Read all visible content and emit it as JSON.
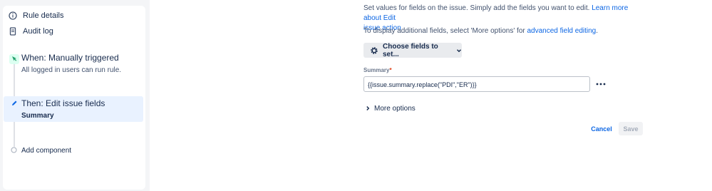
{
  "sidebar": {
    "rule_details": "Rule details",
    "audit_log": "Audit log",
    "trigger": {
      "title": "When: Manually triggered",
      "subtitle": "All logged in users can run rule."
    },
    "action": {
      "title": "Then: Edit issue fields",
      "subtitle": "Summary"
    },
    "add_component": "Add component"
  },
  "main": {
    "intro_text": "Set values for fields on the issue. Simply add the fields you want to edit. ",
    "intro_link_1": "Learn more about Edit",
    "intro_link_2": "issue action",
    "additional_text": "To display additional fields, select 'More options' for ",
    "additional_link": "advanced field editing",
    "additional_end": ".",
    "choose_fields_label": "Choose fields to set...",
    "field_label": "Summary",
    "required_mark": "*",
    "field_value": "{{issue.summary.replace(\"PDI\",\"ER\")}}",
    "more_options": "More options",
    "cancel": "Cancel",
    "save": "Save"
  },
  "colors": {
    "accent": "#0c66e4",
    "trigger_node": "#22a06b",
    "selected_bg": "#e9f2ff",
    "sidebar_bg": "#f4f5f7"
  },
  "icons": {
    "rule_details": "info-icon",
    "audit_log": "document-icon",
    "trigger": "cursor-click-icon",
    "action": "pencil-icon",
    "add": "empty-circle-icon",
    "choose": "gear-icon",
    "choose_chevron": "chevron-down-icon",
    "field_menu": "more-dots-icon",
    "more_options_chevron": "chevron-right-icon"
  }
}
